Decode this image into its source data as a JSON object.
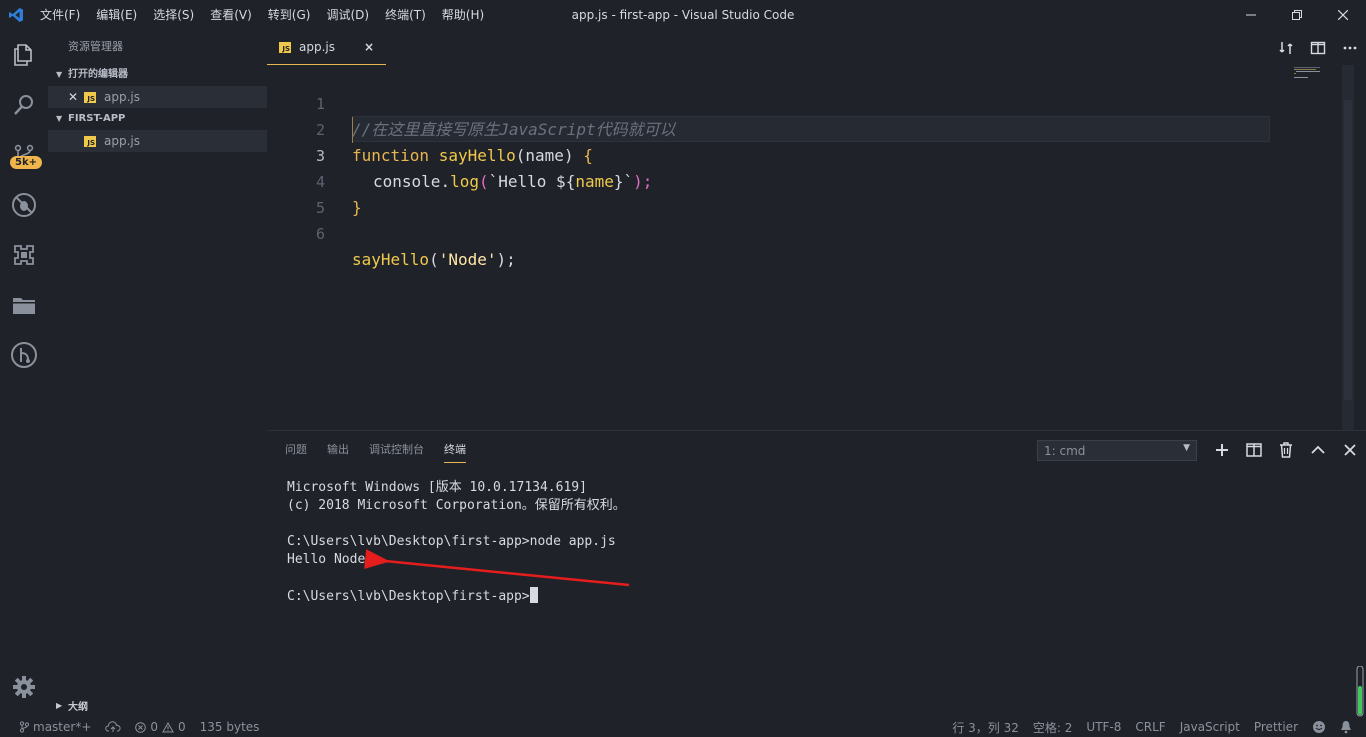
{
  "titlebar": {
    "menu": [
      "文件(F)",
      "编辑(E)",
      "选择(S)",
      "查看(V)",
      "转到(G)",
      "调试(D)",
      "终端(T)",
      "帮助(H)"
    ],
    "title": "app.js - first-app - Visual Studio Code"
  },
  "activitybar": {
    "badge": "5k+"
  },
  "sidebar": {
    "title": "资源管理器",
    "open_editors_label": "打开的编辑器",
    "open_editors": [
      {
        "name": "app.js"
      }
    ],
    "project_label": "FIRST-APP",
    "files": [
      {
        "name": "app.js"
      }
    ],
    "outline_label": "大纲",
    "js_badge": "JS"
  },
  "tab": {
    "label": "app.js",
    "close": "×"
  },
  "editor": {
    "line_numbers": [
      "1",
      "2",
      "3",
      "4",
      "5",
      "6"
    ],
    "lines": {
      "l1_comment": "//在这里直接写原生JavaScript代码就可以",
      "l2_kw": "function",
      "l2_fn": "sayHello",
      "l2_open": "(",
      "l2_param": "name",
      "l2_close": ")",
      "l2_brace": "{",
      "l3_obj": "console",
      "l3_dot": ".",
      "l3_method": "log",
      "l3_open": "(",
      "l3_tpl": "`Hello ${",
      "l3_var": "name",
      "l3_tpl_end": "}`",
      "l3_close": ");",
      "l4_brace": "}",
      "l6_fn": "sayHello",
      "l6_open": "(",
      "l6_str": "'Node'",
      "l6_close": ");"
    }
  },
  "panel": {
    "tabs": [
      "问题",
      "输出",
      "调试控制台",
      "终端"
    ],
    "active_tab": "终端",
    "terminal_select": "1: cmd",
    "terminal_lines": [
      "Microsoft Windows [版本 10.0.17134.619]",
      "(c) 2018 Microsoft Corporation。保留所有权利。",
      "",
      "C:\\Users\\lvb\\Desktop\\first-app>node app.js",
      "Hello Node",
      ""
    ],
    "prompt": "C:\\Users\\lvb\\Desktop\\first-app>"
  },
  "statusbar": {
    "branch": "master*+",
    "errors": "0",
    "warnings": "0",
    "size": "135 bytes",
    "position": "行 3，列 32",
    "spaces": "空格: 2",
    "encoding": "UTF-8",
    "eol": "CRLF",
    "language": "JavaScript",
    "formatter": "Prettier"
  },
  "colors": {
    "background": "#1f2229",
    "accent": "#e8b64f",
    "vscode_blue": "#2f7ed8",
    "annotation_arrow": "#e51d1d"
  }
}
